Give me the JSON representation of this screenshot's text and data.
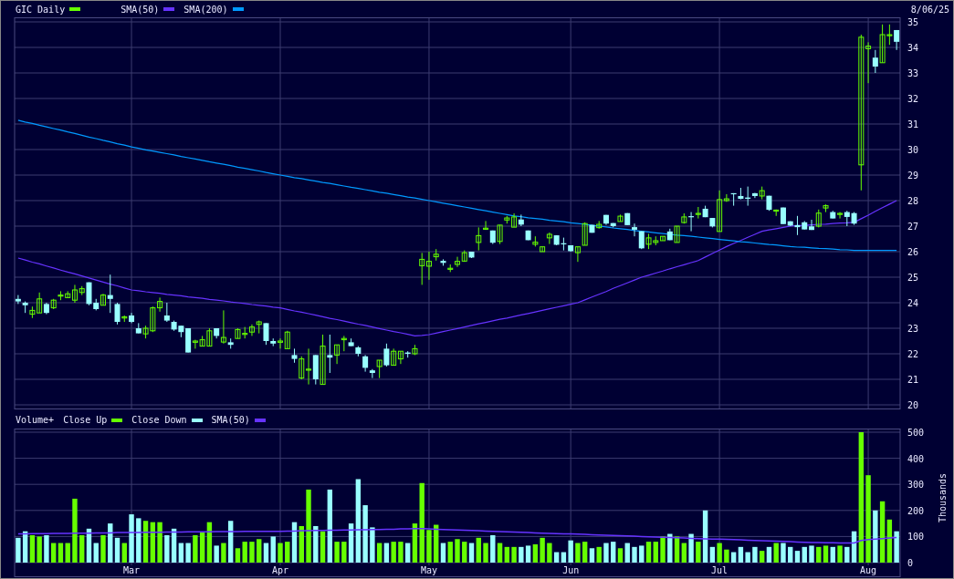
{
  "price_chart": {
    "legend": [
      {
        "label": "GIC Daily",
        "color": "#66ff00"
      }
    ],
    "date": "8/06/25",
    "chart_data": {
      "type": "candlestick",
      "grid": true,
      "ylim": [
        20,
        35
      ],
      "yticks": [
        20,
        21,
        22,
        23,
        24,
        25,
        26,
        27,
        28,
        29,
        30,
        31,
        32,
        33,
        34,
        35
      ],
      "ohlc": [
        [
          24.15,
          24.3,
          23.95,
          24.05
        ],
        [
          24.0,
          24.05,
          23.6,
          23.9
        ],
        [
          23.55,
          23.85,
          23.4,
          23.7
        ],
        [
          23.6,
          24.4,
          23.6,
          24.15
        ],
        [
          23.95,
          24.0,
          23.55,
          23.6
        ],
        [
          23.8,
          24.15,
          23.75,
          24.1
        ],
        [
          24.3,
          24.45,
          24.1,
          24.3
        ],
        [
          24.2,
          24.45,
          24.2,
          24.35
        ],
        [
          24.1,
          24.7,
          24.0,
          24.5
        ],
        [
          24.4,
          24.65,
          24.3,
          24.55
        ],
        [
          24.8,
          24.8,
          23.9,
          23.95
        ],
        [
          24.0,
          24.15,
          23.7,
          23.75
        ],
        [
          23.9,
          24.35,
          23.9,
          24.3
        ],
        [
          24.3,
          25.1,
          23.6,
          24.15
        ],
        [
          23.95,
          24.0,
          23.15,
          23.25
        ],
        [
          23.4,
          23.5,
          23.25,
          23.45
        ],
        [
          23.5,
          23.6,
          23.2,
          23.25
        ],
        [
          23.0,
          23.2,
          22.8,
          22.8
        ],
        [
          22.78,
          23.1,
          22.6,
          23.0
        ],
        [
          22.9,
          23.85,
          22.85,
          23.8
        ],
        [
          23.8,
          24.2,
          23.65,
          24.05
        ],
        [
          23.5,
          24.0,
          23.25,
          23.3
        ],
        [
          23.25,
          23.3,
          22.9,
          22.95
        ],
        [
          23.1,
          23.1,
          22.65,
          22.85
        ],
        [
          23.0,
          23.0,
          22.05,
          22.05
        ],
        [
          22.45,
          22.55,
          22.2,
          22.5
        ],
        [
          22.3,
          22.7,
          22.3,
          22.55
        ],
        [
          22.3,
          23.0,
          22.3,
          22.9
        ],
        [
          23.0,
          23.0,
          22.6,
          22.7
        ],
        [
          22.46,
          23.7,
          22.4,
          22.64
        ],
        [
          22.45,
          22.6,
          22.2,
          22.35
        ],
        [
          22.6,
          23.0,
          22.6,
          22.95
        ],
        [
          22.8,
          23.05,
          22.6,
          22.8
        ],
        [
          22.85,
          23.15,
          22.7,
          23.05
        ],
        [
          23.15,
          23.3,
          22.8,
          23.25
        ],
        [
          23.2,
          23.2,
          22.35,
          22.5
        ],
        [
          22.5,
          22.6,
          22.3,
          22.4
        ],
        [
          22.45,
          22.6,
          22.2,
          22.5
        ],
        [
          22.2,
          22.9,
          22.2,
          22.85
        ],
        [
          21.95,
          22.2,
          21.65,
          21.8
        ],
        [
          21.05,
          21.9,
          21.0,
          21.8
        ],
        [
          21.4,
          22.2,
          20.8,
          21.4
        ],
        [
          21.95,
          21.95,
          20.8,
          21.0
        ],
        [
          20.8,
          22.75,
          20.8,
          22.3
        ],
        [
          21.95,
          22.75,
          21.25,
          21.85
        ],
        [
          21.95,
          22.35,
          21.6,
          22.35
        ],
        [
          22.55,
          22.7,
          22.1,
          22.6
        ],
        [
          22.45,
          22.6,
          22.3,
          22.3
        ],
        [
          22.25,
          22.3,
          21.9,
          22.0
        ],
        [
          21.9,
          21.95,
          21.3,
          21.45
        ],
        [
          21.35,
          21.4,
          21.05,
          21.25
        ],
        [
          21.5,
          21.75,
          21.05,
          21.75
        ],
        [
          22.2,
          22.4,
          21.5,
          21.55
        ],
        [
          21.55,
          22.2,
          21.55,
          22.1
        ],
        [
          21.8,
          22.1,
          21.6,
          22.1
        ],
        [
          22.05,
          22.1,
          21.85,
          22.0
        ],
        [
          22.0,
          22.35,
          21.95,
          22.2
        ],
        [
          25.45,
          25.95,
          24.7,
          25.7
        ],
        [
          25.43,
          26.0,
          24.9,
          25.62
        ],
        [
          25.8,
          26.1,
          25.65,
          25.9
        ],
        [
          25.64,
          25.7,
          25.45,
          25.56
        ],
        [
          25.35,
          25.5,
          25.2,
          25.35
        ],
        [
          25.5,
          25.8,
          25.4,
          25.62
        ],
        [
          25.63,
          26.05,
          25.6,
          25.96
        ],
        [
          26.0,
          26.0,
          25.75,
          25.77
        ],
        [
          26.36,
          26.95,
          26.05,
          26.63
        ],
        [
          26.92,
          27.2,
          26.85,
          26.92
        ],
        [
          26.83,
          26.83,
          26.3,
          26.35
        ],
        [
          26.4,
          27.05,
          26.3,
          27.04
        ],
        [
          27.24,
          27.4,
          27.1,
          27.32
        ],
        [
          26.96,
          27.5,
          26.96,
          27.36
        ],
        [
          27.26,
          27.45,
          27.0,
          27.06
        ],
        [
          26.83,
          26.83,
          26.45,
          26.45
        ],
        [
          26.29,
          26.6,
          26.2,
          26.37
        ],
        [
          26.0,
          26.2,
          26.0,
          26.19
        ],
        [
          26.54,
          26.75,
          26.3,
          26.68
        ],
        [
          26.64,
          26.64,
          26.25,
          26.27
        ],
        [
          26.33,
          26.55,
          26.05,
          26.29
        ],
        [
          26.25,
          26.25,
          26.0,
          26.02
        ],
        [
          25.96,
          26.2,
          25.6,
          26.19
        ],
        [
          26.25,
          27.15,
          26.25,
          27.1
        ],
        [
          27.05,
          27.05,
          26.74,
          26.74
        ],
        [
          26.94,
          27.2,
          26.9,
          27.07
        ],
        [
          27.44,
          27.44,
          27.05,
          27.1
        ],
        [
          27.12,
          27.12,
          26.95,
          27.0
        ],
        [
          27.18,
          27.45,
          27.18,
          27.39
        ],
        [
          27.51,
          27.51,
          27.04,
          27.04
        ],
        [
          26.96,
          27.1,
          26.6,
          26.86
        ],
        [
          26.8,
          26.8,
          26.1,
          26.13
        ],
        [
          26.29,
          26.7,
          26.1,
          26.54
        ],
        [
          26.36,
          26.6,
          26.25,
          26.43
        ],
        [
          26.43,
          26.6,
          26.43,
          26.6
        ],
        [
          26.79,
          26.9,
          26.45,
          26.45
        ],
        [
          26.36,
          27.0,
          26.36,
          27.0
        ],
        [
          27.14,
          27.5,
          27.1,
          27.36
        ],
        [
          27.39,
          27.55,
          26.8,
          27.36
        ],
        [
          27.5,
          27.75,
          27.3,
          27.5
        ],
        [
          27.68,
          27.8,
          27.35,
          27.35
        ],
        [
          27.32,
          27.32,
          26.95,
          26.99
        ],
        [
          26.79,
          28.4,
          26.79,
          28.04
        ],
        [
          28.0,
          28.25,
          27.95,
          28.07
        ],
        [
          28.29,
          28.29,
          27.8,
          28.25
        ],
        [
          28.18,
          28.5,
          28.05,
          28.07
        ],
        [
          28.12,
          28.55,
          27.8,
          28.07
        ],
        [
          28.29,
          28.3,
          28.1,
          28.18
        ],
        [
          28.18,
          28.55,
          28.05,
          28.39
        ],
        [
          28.19,
          28.19,
          27.6,
          27.64
        ],
        [
          27.63,
          27.65,
          27.4,
          27.63
        ],
        [
          27.73,
          27.73,
          27.08,
          27.08
        ],
        [
          27.19,
          27.19,
          27.0,
          27.02
        ],
        [
          27.04,
          27.4,
          26.65,
          26.96
        ],
        [
          27.15,
          27.2,
          26.87,
          26.87
        ],
        [
          26.99,
          27.25,
          26.85,
          26.85
        ],
        [
          27.0,
          27.65,
          26.95,
          27.51
        ],
        [
          27.71,
          27.85,
          27.55,
          27.8
        ],
        [
          27.55,
          27.6,
          27.3,
          27.3
        ],
        [
          27.5,
          27.55,
          27.3,
          27.5
        ],
        [
          27.55,
          27.6,
          27.0,
          27.36
        ],
        [
          27.51,
          27.55,
          27.05,
          27.1
        ],
        [
          29.4,
          34.5,
          28.4,
          34.4
        ],
        [
          33.95,
          34.2,
          32.6,
          34.05
        ],
        [
          33.6,
          33.9,
          33.0,
          33.25
        ],
        [
          33.4,
          34.9,
          33.4,
          34.5
        ],
        [
          34.5,
          34.9,
          34.1,
          34.5
        ],
        [
          34.68,
          34.68,
          33.9,
          34.22
        ]
      ],
      "series": [
        {
          "name": "SMA(50)",
          "type": "line",
          "color": "#6633ff",
          "values": [
            25.75,
            25.67,
            25.59,
            25.52,
            25.44,
            25.36,
            25.28,
            25.2,
            25.13,
            25.05,
            24.97,
            24.89,
            24.81,
            24.73,
            24.66,
            24.58,
            24.5,
            24.47,
            24.43,
            24.4,
            24.37,
            24.33,
            24.3,
            24.27,
            24.23,
            24.2,
            24.17,
            24.13,
            24.1,
            24.07,
            24.03,
            24.0,
            23.97,
            23.93,
            23.9,
            23.87,
            23.83,
            23.8,
            23.74,
            23.68,
            23.63,
            23.57,
            23.51,
            23.45,
            23.39,
            23.34,
            23.28,
            23.22,
            23.16,
            23.11,
            23.05,
            22.99,
            22.93,
            22.87,
            22.82,
            22.76,
            22.7,
            22.72,
            22.75,
            22.81,
            22.87,
            22.93,
            22.99,
            23.05,
            23.11,
            23.17,
            23.23,
            23.29,
            23.35,
            23.4,
            23.46,
            23.52,
            23.58,
            23.64,
            23.7,
            23.76,
            23.82,
            23.88,
            23.94,
            24.0,
            24.11,
            24.22,
            24.33,
            24.44,
            24.56,
            24.67,
            24.78,
            24.89,
            25.0,
            25.08,
            25.16,
            25.24,
            25.33,
            25.41,
            25.49,
            25.57,
            25.65,
            25.79,
            25.93,
            26.06,
            26.2,
            26.32,
            26.44,
            26.56,
            26.68,
            26.8,
            26.85,
            26.9,
            26.95,
            27.0,
            27.02,
            27.03,
            27.05,
            27.07,
            27.08,
            27.1,
            27.12,
            27.13,
            27.15,
            27.29,
            27.43,
            27.58,
            27.72,
            27.86,
            28.0
          ]
        },
        {
          "name": "SMA(200)",
          "type": "line",
          "color": "#0099ff",
          "values": [
            31.15,
            31.08,
            31.02,
            30.95,
            30.89,
            30.82,
            30.76,
            30.69,
            30.63,
            30.56,
            30.49,
            30.43,
            30.36,
            30.3,
            30.23,
            30.17,
            30.1,
            30.05,
            29.99,
            29.94,
            29.89,
            29.84,
            29.79,
            29.73,
            29.68,
            29.63,
            29.58,
            29.52,
            29.47,
            29.42,
            29.37,
            29.31,
            29.26,
            29.21,
            29.16,
            29.1,
            29.05,
            29.0,
            28.95,
            28.9,
            28.86,
            28.81,
            28.76,
            28.71,
            28.67,
            28.62,
            28.57,
            28.52,
            28.48,
            28.43,
            28.38,
            28.33,
            28.29,
            28.24,
            28.19,
            28.14,
            28.1,
            28.05,
            28.0,
            27.95,
            27.9,
            27.85,
            27.8,
            27.75,
            27.7,
            27.65,
            27.6,
            27.55,
            27.5,
            27.45,
            27.4,
            27.37,
            27.33,
            27.3,
            27.27,
            27.23,
            27.2,
            27.17,
            27.13,
            27.1,
            27.07,
            27.03,
            27.0,
            26.97,
            26.93,
            26.9,
            26.87,
            26.83,
            26.8,
            26.77,
            26.74,
            26.71,
            26.68,
            26.65,
            26.63,
            26.6,
            26.57,
            26.54,
            26.51,
            26.48,
            26.45,
            26.42,
            26.39,
            26.37,
            26.34,
            26.31,
            26.28,
            26.26,
            26.23,
            26.2,
            26.18,
            26.17,
            26.15,
            26.13,
            26.12,
            26.1,
            26.08,
            26.07,
            26.05,
            26.05,
            26.05,
            26.05,
            26.05,
            26.05,
            26.05
          ]
        }
      ]
    }
  },
  "volume_chart": {
    "legend": [
      {
        "label": "Close Up",
        "color": "#66ff00"
      },
      {
        "label": "Close Down",
        "color": "#99ffff"
      }
    ],
    "chart_data": {
      "type": "bar",
      "grid": true,
      "ylabel": "Thousands",
      "ylim": [
        0,
        500
      ],
      "yticks": [
        0,
        100,
        200,
        300,
        400,
        500
      ],
      "categories": [
        null,
        null,
        null,
        null,
        null,
        null,
        null,
        null,
        null,
        null,
        null,
        null,
        null,
        null,
        null,
        null,
        "Mar",
        null,
        null,
        null,
        null,
        null,
        null,
        null,
        null,
        null,
        null,
        null,
        null,
        null,
        null,
        null,
        null,
        null,
        null,
        null,
        null,
        "Apr",
        null,
        null,
        null,
        null,
        null,
        null,
        null,
        null,
        null,
        null,
        null,
        null,
        null,
        null,
        null,
        null,
        null,
        null,
        null,
        null,
        "May",
        null,
        null,
        null,
        null,
        null,
        null,
        null,
        null,
        null,
        null,
        null,
        null,
        null,
        null,
        null,
        null,
        null,
        null,
        null,
        "Jun",
        null,
        null,
        null,
        null,
        null,
        null,
        null,
        null,
        null,
        null,
        null,
        null,
        null,
        null,
        null,
        null,
        null,
        null,
        null,
        null,
        "Jul",
        null,
        null,
        null,
        null,
        null,
        null,
        null,
        null,
        null,
        null,
        null,
        null,
        null,
        null,
        null,
        null,
        null,
        null,
        null,
        null,
        "Aug",
        null,
        null,
        null,
        null
      ],
      "series": [
        {
          "name": "Volume+",
          "colors": [
            "#99ffff",
            "#99ffff",
            "#66ff00",
            "#66ff00",
            "#99ffff",
            "#66ff00",
            "#66ff00",
            "#66ff00",
            "#66ff00",
            "#66ff00",
            "#99ffff",
            "#99ffff",
            "#66ff00",
            "#99ffff",
            "#99ffff",
            "#66ff00",
            "#99ffff",
            "#99ffff",
            "#66ff00",
            "#66ff00",
            "#66ff00",
            "#99ffff",
            "#99ffff",
            "#99ffff",
            "#99ffff",
            "#66ff00",
            "#66ff00",
            "#66ff00",
            "#99ffff",
            "#66ff00",
            "#99ffff",
            "#66ff00",
            "#66ff00",
            "#66ff00",
            "#66ff00",
            "#99ffff",
            "#99ffff",
            "#66ff00",
            "#66ff00",
            "#99ffff",
            "#66ff00",
            "#66ff00",
            "#99ffff",
            "#66ff00",
            "#99ffff",
            "#66ff00",
            "#66ff00",
            "#99ffff",
            "#99ffff",
            "#99ffff",
            "#99ffff",
            "#66ff00",
            "#99ffff",
            "#66ff00",
            "#66ff00",
            "#99ffff",
            "#66ff00",
            "#66ff00",
            "#66ff00",
            "#66ff00",
            "#99ffff",
            "#66ff00",
            "#66ff00",
            "#66ff00",
            "#99ffff",
            "#66ff00",
            "#66ff00",
            "#99ffff",
            "#66ff00",
            "#66ff00",
            "#66ff00",
            "#99ffff",
            "#99ffff",
            "#66ff00",
            "#66ff00",
            "#66ff00",
            "#99ffff",
            "#99ffff",
            "#99ffff",
            "#66ff00",
            "#66ff00",
            "#99ffff",
            "#66ff00",
            "#99ffff",
            "#99ffff",
            "#66ff00",
            "#99ffff",
            "#99ffff",
            "#99ffff",
            "#66ff00",
            "#66ff00",
            "#66ff00",
            "#99ffff",
            "#66ff00",
            "#66ff00",
            "#99ffff",
            "#66ff00",
            "#99ffff",
            "#99ffff",
            "#66ff00",
            "#66ff00",
            "#99ffff",
            "#99ffff",
            "#99ffff",
            "#99ffff",
            "#66ff00",
            "#99ffff",
            "#66ff00",
            "#99ffff",
            "#99ffff",
            "#99ffff",
            "#99ffff",
            "#99ffff",
            "#66ff00",
            "#66ff00",
            "#99ffff",
            "#66ff00",
            "#99ffff",
            "#99ffff",
            "#66ff00",
            "#66ff00",
            "#99ffff",
            "#66ff00",
            "#66ff00",
            "#99ffff"
          ],
          "values": [
            95,
            120,
            105,
            100,
            105,
            75,
            75,
            75,
            245,
            105,
            130,
            75,
            105,
            150,
            95,
            75,
            185,
            170,
            160,
            155,
            155,
            105,
            130,
            75,
            75,
            105,
            115,
            155,
            65,
            75,
            160,
            55,
            80,
            80,
            90,
            75,
            100,
            75,
            80,
            155,
            140,
            280,
            140,
            120,
            280,
            80,
            80,
            150,
            320,
            220,
            135,
            75,
            75,
            80,
            80,
            75,
            150,
            305,
            125,
            145,
            75,
            80,
            90,
            80,
            75,
            95,
            75,
            105,
            75,
            60,
            60,
            60,
            65,
            70,
            95,
            75,
            40,
            40,
            85,
            75,
            80,
            55,
            60,
            75,
            80,
            55,
            75,
            60,
            65,
            80,
            80,
            100,
            110,
            100,
            75,
            110,
            80,
            200,
            60,
            75,
            50,
            40,
            60,
            40,
            60,
            45,
            60,
            75,
            75,
            60,
            45,
            60,
            65,
            60,
            65,
            60,
            65,
            60,
            120,
            500,
            335,
            200,
            235,
            165,
            120
          ]
        },
        {
          "name": "SMA(50)",
          "type": "line",
          "color": "#6633ff",
          "values": [
            110,
            110,
            111,
            111,
            111,
            112,
            112,
            112,
            113,
            113,
            113,
            114,
            114,
            114,
            115,
            115,
            115,
            115,
            116,
            116,
            116,
            117,
            117,
            117,
            118,
            118,
            118,
            118,
            119,
            119,
            119,
            119,
            120,
            120,
            120,
            120,
            120,
            120,
            121,
            121,
            122,
            122,
            123,
            123,
            124,
            124,
            125,
            125,
            126,
            126,
            127,
            127,
            128,
            128,
            129,
            129,
            130,
            130,
            129,
            128,
            127,
            126,
            125,
            124,
            123,
            122,
            121,
            120,
            119,
            118,
            117,
            116,
            115,
            114,
            113,
            112,
            111,
            110,
            110,
            109,
            108,
            107,
            106,
            105,
            104,
            103,
            102,
            101,
            100,
            99,
            98,
            97,
            96,
            95,
            94,
            93,
            92,
            91,
            90,
            90,
            89,
            88,
            87,
            86,
            85,
            84,
            83,
            82,
            81,
            80,
            79,
            78,
            77,
            77,
            76,
            76,
            75,
            75,
            75,
            85,
            88,
            90,
            92,
            94,
            96
          ]
        }
      ]
    }
  }
}
